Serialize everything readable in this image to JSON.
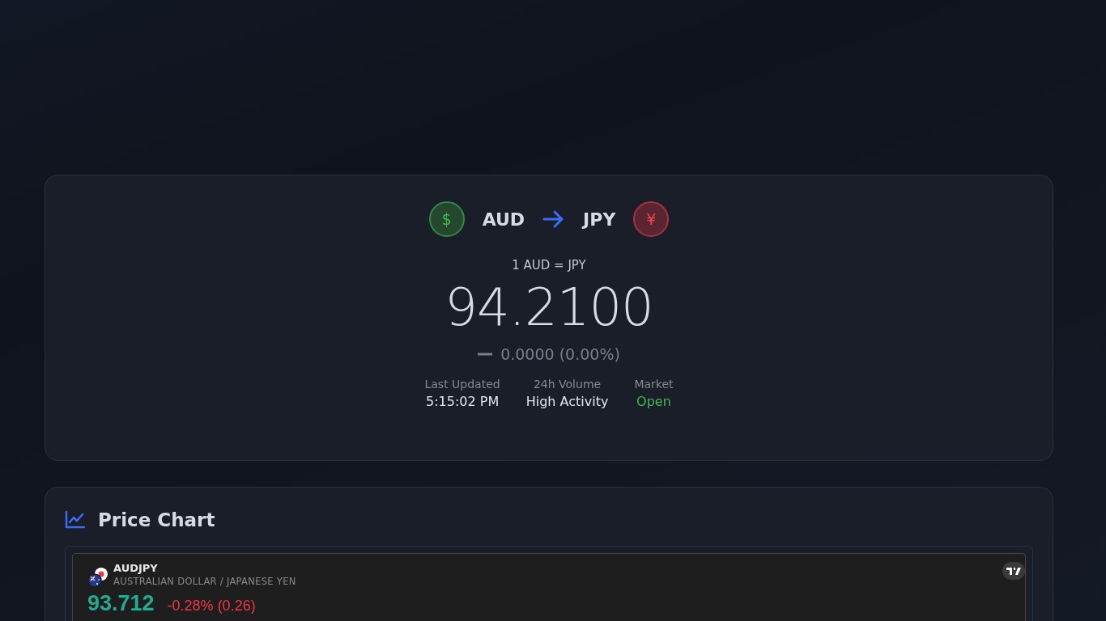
{
  "converter": {
    "from": {
      "code": "AUD",
      "symbol": "$"
    },
    "to": {
      "code": "JPY",
      "symbol": "¥"
    },
    "rate_label": "1 AUD = JPY",
    "rate": "94.2100",
    "change": {
      "kind": "flat",
      "text": "0.0000 (0.00%)"
    },
    "stats": [
      {
        "label": "Last Updated",
        "value": "5:15:02 PM",
        "kind": "plain"
      },
      {
        "label": "24h Volume",
        "value": "High Activity",
        "kind": "plain"
      },
      {
        "label": "Market",
        "value": "Open",
        "kind": "status",
        "open": true
      }
    ]
  },
  "chart": {
    "title": "Price Chart",
    "widget": {
      "symbol": "AUDJPY",
      "name": "AUSTRALIAN DOLLAR / JAPANESE YEN",
      "price": "93.712",
      "change": "-0.28% (0.26)",
      "negative": true
    }
  }
}
